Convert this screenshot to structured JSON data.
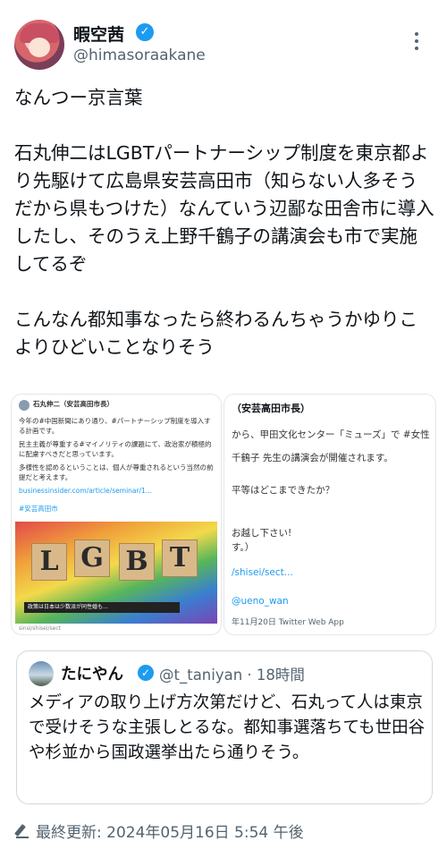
{
  "author": {
    "display_name": "暇空茜",
    "handle": "@himasoraakane"
  },
  "tweet": {
    "text": "なんつー京言葉\n\n石丸伸二はLGBTパートナーシップ制度を東京都より先駆けて広島県安芸高田市（知らない人多そうだから県もつけた）なんていう辺鄙な田舎市に導入したし、そのうえ上野千鶴子の講演会も市で実施してるぞ\n\nこんなん都知事なったら終わるんちゃうかゆりこよりひどいことなりそう"
  },
  "media": {
    "left_card": {
      "author": "石丸伸二（安芸高田市長）",
      "line1": "今年の#中国新聞にあり通り、#パートナーシップ制度を導入する計画です。",
      "line2": "民主主義が尊重する#マイノリティの課題にて、政治家が積極的に配慮すべきだと思っています。",
      "line3": "多様性を認めるということは、個人が尊重されるという当然の前提だと考えます。",
      "link": "businessinsider.com/article/seminar/1...",
      "hashtag": "#安芸高田市",
      "blocks": [
        "L",
        "G",
        "B",
        "T"
      ],
      "caption": "政策は日本は少数派が同性婚も…",
      "source": "sinsi/shisei/sect"
    },
    "right_card": {
      "title": "（安芸高田市長）",
      "line1": "から、甲田文化センター「ミューズ」で #女性",
      "line2": "千鶴子 先生の講演会が開催されます。",
      "line3": "平等はどこまできたか？",
      "line4": "お越し下さい!",
      "line5": "す。）",
      "link": "/shisei/sect...",
      "mention": "@ueno_wan",
      "footer": "年11月20日 Twitter Web App"
    }
  },
  "quote": {
    "display_name": "たにやん",
    "handle_time": "@t_taniyan · 18時間",
    "text": "メディアの取り上げ方次第だけど、石丸って人は東京で受けそうな主張しとるな。都知事選落ちても世田谷や杉並から国政選挙出たら通りそう。"
  },
  "footer": {
    "last_updated": "最終更新: 2024年05月16日 5:54 午後"
  },
  "icons": {
    "verified": "verified-badge-icon",
    "more": "more-dots-icon",
    "edit": "edit-pencil-icon"
  },
  "colors": {
    "accent": "#1d9bf0",
    "muted": "#536471"
  }
}
